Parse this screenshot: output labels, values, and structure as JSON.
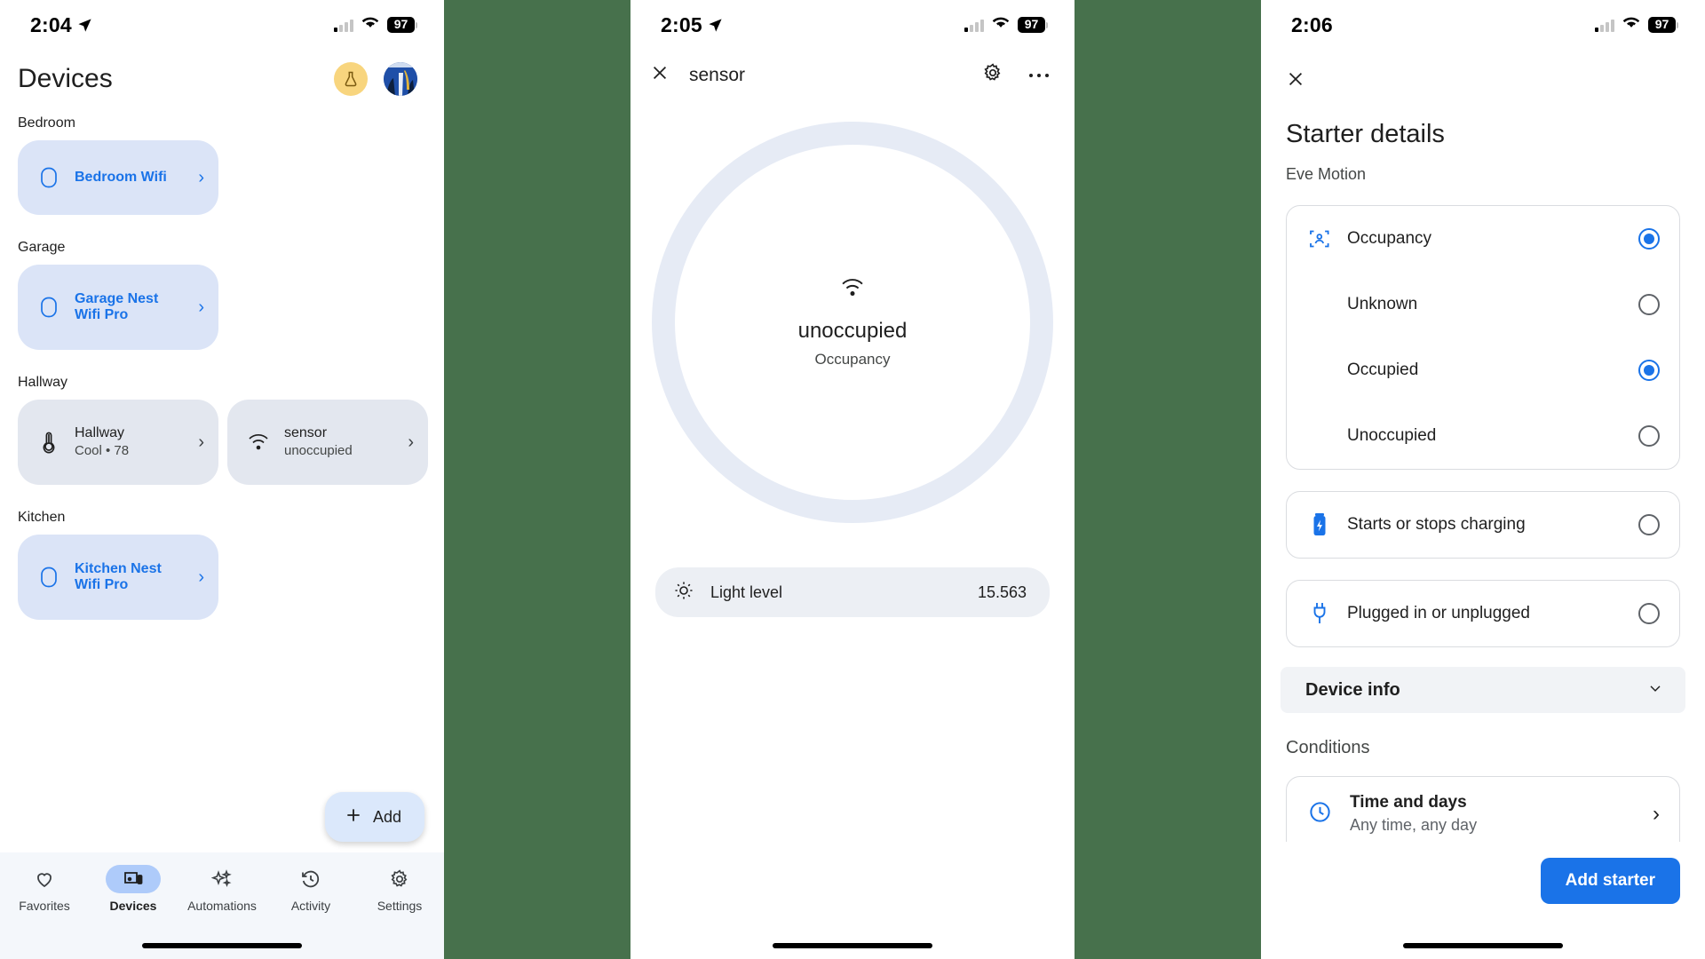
{
  "background_color": "#47714C",
  "accent_color": "#1A73E8",
  "devices_screen": {
    "status_bar": {
      "time": "2:04",
      "battery": "97",
      "location_icon": "location-arrow-icon",
      "wifi_icon": "wifi-icon",
      "signal_icon": "cellular-bars-icon"
    },
    "header": {
      "title": "Devices",
      "flask_avatar_icon": "flask-icon",
      "profile_avatar_icon": "avatar-icon"
    },
    "rooms": [
      {
        "label": "Bedroom",
        "devices": [
          {
            "name": "Bedroom Wifi",
            "subtitle": "",
            "icon": "wifi-point-icon",
            "style": "blue",
            "chevron": "›"
          }
        ]
      },
      {
        "label": "Garage",
        "devices": [
          {
            "name": "Garage Nest Wifi Pro",
            "subtitle": "",
            "icon": "wifi-point-icon",
            "style": "blue",
            "chevron": "›"
          }
        ]
      },
      {
        "label": "Hallway",
        "devices": [
          {
            "name": "Hallway",
            "subtitle": "Cool • 78",
            "icon": "thermostat-icon",
            "style": "grey",
            "chevron": "›"
          },
          {
            "name": "sensor",
            "subtitle": "unoccupied",
            "icon": "motion-sensor-icon",
            "style": "grey",
            "chevron": "›"
          }
        ]
      },
      {
        "label": "Kitchen",
        "devices": [
          {
            "name": "Kitchen Nest Wifi Pro",
            "subtitle": "",
            "icon": "wifi-point-icon",
            "style": "blue",
            "chevron": "›"
          }
        ]
      }
    ],
    "fab": {
      "label": "Add",
      "icon": "plus-icon"
    },
    "bottom_nav": [
      {
        "label": "Favorites",
        "icon": "heart-icon",
        "active": false
      },
      {
        "label": "Devices",
        "icon": "devices-icon",
        "active": true
      },
      {
        "label": "Automations",
        "icon": "sparkles-icon",
        "active": false
      },
      {
        "label": "Activity",
        "icon": "history-icon",
        "active": false
      },
      {
        "label": "Settings",
        "icon": "gear-icon",
        "active": false
      }
    ]
  },
  "sensor_screen": {
    "status_bar": {
      "time": "2:05",
      "battery": "97"
    },
    "topbar": {
      "close_icon": "close-icon",
      "title": "sensor",
      "settings_icon": "gear-icon",
      "overflow_icon": "more-options-icon"
    },
    "dial": {
      "icon": "motion-sensor-icon",
      "state": "unoccupied",
      "label": "Occupancy"
    },
    "light_level": {
      "icon": "brightness-icon",
      "label": "Light level",
      "value": "15.563"
    }
  },
  "starter_screen": {
    "status_bar": {
      "time": "2:06",
      "battery": "97"
    },
    "topbar": {
      "close_icon": "close-icon"
    },
    "title": "Starter details",
    "device_name": "Eve Motion",
    "trigger_card": [
      {
        "label": "Occupancy",
        "icon": "occupancy-sensor-icon",
        "selected": true,
        "is_sub": false
      },
      {
        "label": "Unknown",
        "icon": "",
        "selected": false,
        "is_sub": true
      },
      {
        "label": "Occupied",
        "icon": "",
        "selected": true,
        "is_sub": true
      },
      {
        "label": "Unoccupied",
        "icon": "",
        "selected": false,
        "is_sub": true
      }
    ],
    "other_triggers": [
      {
        "label": "Starts or stops charging",
        "icon": "battery-charging-icon",
        "selected": false
      },
      {
        "label": "Plugged in or unplugged",
        "icon": "power-plug-icon",
        "selected": false
      }
    ],
    "device_info": {
      "label": "Device info",
      "chevron_icon": "chevron-down-icon"
    },
    "conditions_heading": "Conditions",
    "condition_item": {
      "icon": "clock-icon",
      "title": "Time and days",
      "subtitle": "Any time, any day",
      "chevron": "›"
    },
    "footer": {
      "primary_button": "Add starter"
    }
  }
}
